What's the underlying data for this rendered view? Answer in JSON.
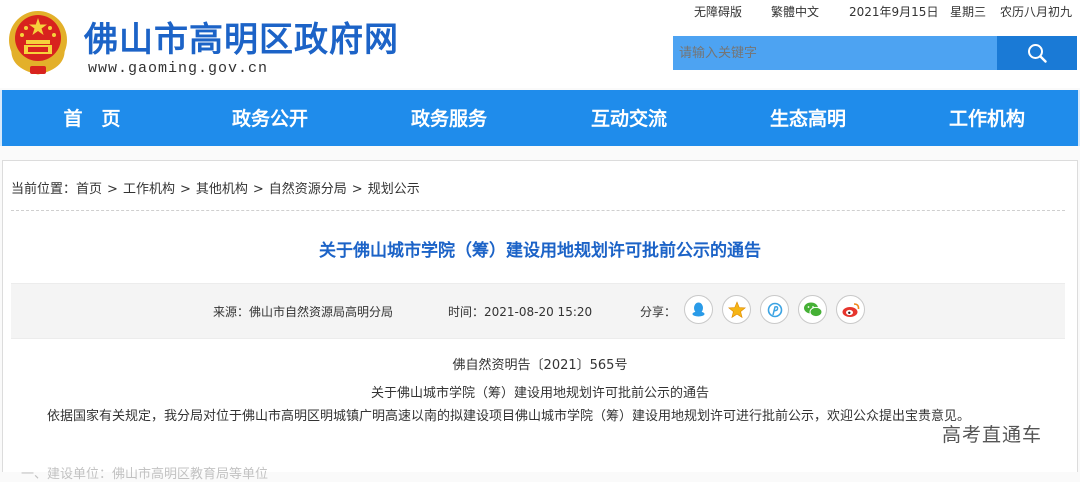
{
  "header": {
    "site_title": "佛山市高明区政府网",
    "domain": "www.gaoming.gov.cn"
  },
  "top_links": {
    "accessibility": "无障碍版",
    "traditional": "繁體中文",
    "date": "2021年9月15日",
    "weekday": "星期三",
    "lunar": "农历八月初九"
  },
  "search": {
    "placeholder": "请输入关键字"
  },
  "nav": {
    "items": [
      {
        "label": "首　页"
      },
      {
        "label": "政务公开"
      },
      {
        "label": "政务服务"
      },
      {
        "label": "互动交流"
      },
      {
        "label": "生态高明"
      },
      {
        "label": "工作机构"
      }
    ]
  },
  "breadcrumb": {
    "prefix": "当前位置：",
    "items": [
      "首页",
      "工作机构",
      "其他机构",
      "自然资源分局",
      "规划公示"
    ],
    "separator": ">"
  },
  "article": {
    "title": "关于佛山城市学院（筹）建设用地规划许可批前公示的通告",
    "source": "来源：佛山市自然资源局高明分局",
    "time": "时间：2021-08-20 15:20",
    "share_label": "分享：",
    "doc_number": "佛自然资明告〔2021〕565号",
    "doc_title": "关于佛山城市学院（筹）建设用地规划许可批前公示的通告",
    "body": "依据国家有关规定，我分局对位于佛山市高明区明城镇广明高速以南的拟建设项目佛山城市学院（筹）建设用地规划许可进行批前公示，欢迎公众提出宝贵意见。",
    "faded_line": "一、建设单位：佛山市高明区教育局等单位"
  },
  "share_icons": [
    "qq-icon",
    "qzone-icon",
    "weibo-tencent-icon",
    "wechat-icon",
    "sina-weibo-icon"
  ],
  "watermark": "高考直通车",
  "colors": {
    "brand_blue": "#1c63c7",
    "nav_blue": "#1f8ceb",
    "search_blue": "#4da3f2"
  }
}
